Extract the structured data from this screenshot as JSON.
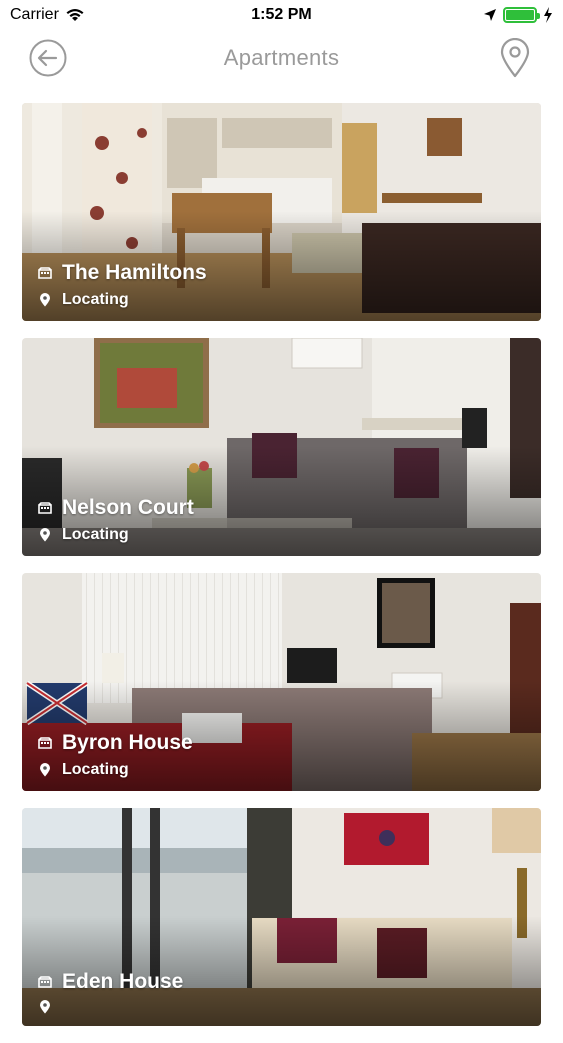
{
  "status_bar": {
    "carrier": "Carrier",
    "time": "1:52 PM",
    "battery_level": 1.0
  },
  "nav": {
    "title": "Apartments",
    "back_icon": "back-arrow-icon",
    "map_icon": "map-pin-icon"
  },
  "apartments": [
    {
      "name": "The Hamiltons",
      "location": "Locating"
    },
    {
      "name": "Nelson Court",
      "location": "Locating"
    },
    {
      "name": "Byron House",
      "location": "Locating"
    },
    {
      "name": "Eden House",
      "location": ""
    }
  ]
}
